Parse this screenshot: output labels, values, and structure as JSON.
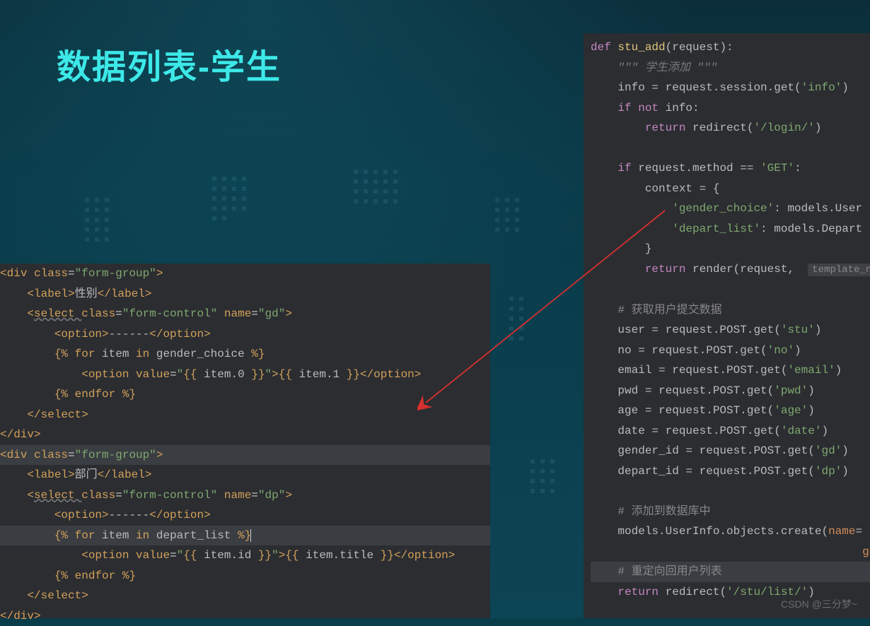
{
  "title": "数据列表-学生",
  "watermark": "CSDN @三分梦~",
  "left_code": {
    "lines": [
      {
        "indent": 0,
        "tokens": [
          {
            "t": "<",
            "c": "tag"
          },
          {
            "t": "div ",
            "c": "tag"
          },
          {
            "t": "class",
            "c": "attr"
          },
          {
            "t": "=",
            "c": "op"
          },
          {
            "t": "\"form-group\"",
            "c": "str"
          },
          {
            "t": ">",
            "c": "tag"
          }
        ]
      },
      {
        "indent": 1,
        "tokens": [
          {
            "t": "<",
            "c": "tag"
          },
          {
            "t": "label",
            "c": "tag"
          },
          {
            "t": ">",
            "c": "tag"
          },
          {
            "t": "性别",
            "c": "txt"
          },
          {
            "t": "</",
            "c": "tag"
          },
          {
            "t": "label",
            "c": "tag"
          },
          {
            "t": ">",
            "c": "tag"
          }
        ]
      },
      {
        "indent": 1,
        "tokens": [
          {
            "t": "<",
            "c": "tag"
          },
          {
            "t": "select ",
            "c": "tag underline"
          },
          {
            "t": "class",
            "c": "attr"
          },
          {
            "t": "=",
            "c": "op"
          },
          {
            "t": "\"form-control\"",
            "c": "str"
          },
          {
            "t": " name",
            "c": "attr"
          },
          {
            "t": "=",
            "c": "op"
          },
          {
            "t": "\"gd\"",
            "c": "str"
          },
          {
            "t": ">",
            "c": "tag"
          }
        ]
      },
      {
        "indent": 2,
        "tokens": [
          {
            "t": "<",
            "c": "tag"
          },
          {
            "t": "option",
            "c": "tag"
          },
          {
            "t": ">",
            "c": "tag"
          },
          {
            "t": "------",
            "c": "txt"
          },
          {
            "t": "</",
            "c": "tag"
          },
          {
            "t": "option",
            "c": "tag"
          },
          {
            "t": ">",
            "c": "tag"
          }
        ]
      },
      {
        "indent": 2,
        "tokens": [
          {
            "t": "{% ",
            "c": "dj"
          },
          {
            "t": "for ",
            "c": "dj"
          },
          {
            "t": "item ",
            "c": "txt"
          },
          {
            "t": "in ",
            "c": "dj"
          },
          {
            "t": "gender_choice ",
            "c": "txt"
          },
          {
            "t": "%}",
            "c": "dj"
          }
        ]
      },
      {
        "indent": 3,
        "tokens": [
          {
            "t": "<",
            "c": "tag"
          },
          {
            "t": "option ",
            "c": "tag"
          },
          {
            "t": "value",
            "c": "attr"
          },
          {
            "t": "=",
            "c": "op"
          },
          {
            "t": "\"",
            "c": "str"
          },
          {
            "t": "{{ ",
            "c": "dj"
          },
          {
            "t": "item.0 ",
            "c": "txt"
          },
          {
            "t": "}}",
            "c": "dj"
          },
          {
            "t": "\"",
            "c": "str"
          },
          {
            "t": ">",
            "c": "tag"
          },
          {
            "t": "{{ ",
            "c": "dj"
          },
          {
            "t": "item.1 ",
            "c": "txt"
          },
          {
            "t": "}}",
            "c": "dj"
          },
          {
            "t": "</",
            "c": "tag"
          },
          {
            "t": "option",
            "c": "tag"
          },
          {
            "t": ">",
            "c": "tag"
          }
        ]
      },
      {
        "indent": 2,
        "tokens": [
          {
            "t": "{% ",
            "c": "dj"
          },
          {
            "t": "endfor ",
            "c": "dj"
          },
          {
            "t": "%}",
            "c": "dj"
          }
        ]
      },
      {
        "indent": 1,
        "tokens": [
          {
            "t": "</",
            "c": "tag"
          },
          {
            "t": "select",
            "c": "tag"
          },
          {
            "t": ">",
            "c": "tag"
          }
        ]
      },
      {
        "indent": 0,
        "tokens": [
          {
            "t": "</",
            "c": "tag"
          },
          {
            "t": "div",
            "c": "tag"
          },
          {
            "t": ">",
            "c": "tag"
          }
        ]
      },
      {
        "indent": 0,
        "hl": true,
        "tokens": [
          {
            "t": "<",
            "c": "tag"
          },
          {
            "t": "div ",
            "c": "tag"
          },
          {
            "t": "class",
            "c": "attr"
          },
          {
            "t": "=",
            "c": "op"
          },
          {
            "t": "\"form-group\"",
            "c": "str"
          },
          {
            "t": ">",
            "c": "tag"
          }
        ]
      },
      {
        "indent": 1,
        "tokens": [
          {
            "t": "<",
            "c": "tag"
          },
          {
            "t": "label",
            "c": "tag"
          },
          {
            "t": ">",
            "c": "tag"
          },
          {
            "t": "部门",
            "c": "txt"
          },
          {
            "t": "</",
            "c": "tag"
          },
          {
            "t": "label",
            "c": "tag"
          },
          {
            "t": ">",
            "c": "tag"
          }
        ]
      },
      {
        "indent": 1,
        "tokens": [
          {
            "t": "<",
            "c": "tag"
          },
          {
            "t": "select ",
            "c": "tag underline"
          },
          {
            "t": "class",
            "c": "attr"
          },
          {
            "t": "=",
            "c": "op"
          },
          {
            "t": "\"form-control\"",
            "c": "str"
          },
          {
            "t": " name",
            "c": "attr"
          },
          {
            "t": "=",
            "c": "op"
          },
          {
            "t": "\"dp\"",
            "c": "str"
          },
          {
            "t": ">",
            "c": "tag"
          }
        ]
      },
      {
        "indent": 2,
        "tokens": [
          {
            "t": "<",
            "c": "tag"
          },
          {
            "t": "option",
            "c": "tag"
          },
          {
            "t": ">",
            "c": "tag"
          },
          {
            "t": "------",
            "c": "txt"
          },
          {
            "t": "</",
            "c": "tag"
          },
          {
            "t": "option",
            "c": "tag"
          },
          {
            "t": ">",
            "c": "tag"
          }
        ]
      },
      {
        "indent": 2,
        "hl": true,
        "tokens": [
          {
            "t": "{% ",
            "c": "dj"
          },
          {
            "t": "for ",
            "c": "dj"
          },
          {
            "t": "item ",
            "c": "txt"
          },
          {
            "t": "in ",
            "c": "dj"
          },
          {
            "t": "depart_list ",
            "c": "txt"
          },
          {
            "t": "%}",
            "c": "dj"
          },
          {
            "t": "",
            "c": "cursor"
          }
        ]
      },
      {
        "indent": 3,
        "tokens": [
          {
            "t": "<",
            "c": "tag"
          },
          {
            "t": "option ",
            "c": "tag"
          },
          {
            "t": "value",
            "c": "attr"
          },
          {
            "t": "=",
            "c": "op"
          },
          {
            "t": "\"",
            "c": "str"
          },
          {
            "t": "{{ ",
            "c": "dj"
          },
          {
            "t": "item.id ",
            "c": "txt"
          },
          {
            "t": "}}",
            "c": "dj"
          },
          {
            "t": "\"",
            "c": "str"
          },
          {
            "t": ">",
            "c": "tag"
          },
          {
            "t": "{{ ",
            "c": "dj"
          },
          {
            "t": "item.title ",
            "c": "txt"
          },
          {
            "t": "}}",
            "c": "dj"
          },
          {
            "t": "</",
            "c": "tag"
          },
          {
            "t": "option",
            "c": "tag"
          },
          {
            "t": ">",
            "c": "tag"
          }
        ]
      },
      {
        "indent": 2,
        "tokens": [
          {
            "t": "{% ",
            "c": "dj"
          },
          {
            "t": "endfor ",
            "c": "dj"
          },
          {
            "t": "%}",
            "c": "dj"
          }
        ]
      },
      {
        "indent": 1,
        "tokens": [
          {
            "t": "</",
            "c": "tag"
          },
          {
            "t": "select",
            "c": "tag"
          },
          {
            "t": ">",
            "c": "tag"
          }
        ]
      },
      {
        "indent": 0,
        "tokens": [
          {
            "t": "</",
            "c": "tag"
          },
          {
            "t": "div",
            "c": "tag"
          },
          {
            "t": ">",
            "c": "tag"
          }
        ]
      }
    ]
  },
  "right_code": {
    "lines": [
      {
        "indent": 0,
        "tokens": [
          {
            "t": "def ",
            "c": "kw2"
          },
          {
            "t": "stu_add",
            "c": "fn"
          },
          {
            "t": "(request):",
            "c": "txt"
          }
        ]
      },
      {
        "indent": 1,
        "tokens": [
          {
            "t": "\"\"\" ",
            "c": "docstr"
          },
          {
            "t": "学生添加",
            "c": "docstr"
          },
          {
            "t": " \"\"\"",
            "c": "docstr"
          }
        ]
      },
      {
        "indent": 1,
        "tokens": [
          {
            "t": "info = request.session.get(",
            "c": "txt"
          },
          {
            "t": "'info'",
            "c": "str2"
          },
          {
            "t": ")",
            "c": "txt"
          }
        ]
      },
      {
        "indent": 1,
        "tokens": [
          {
            "t": "if ",
            "c": "kw2"
          },
          {
            "t": "not ",
            "c": "kw2"
          },
          {
            "t": "info:",
            "c": "txt"
          }
        ]
      },
      {
        "indent": 2,
        "tokens": [
          {
            "t": "return ",
            "c": "kw2"
          },
          {
            "t": "redirect(",
            "c": "txt"
          },
          {
            "t": "'/login/'",
            "c": "str2"
          },
          {
            "t": ")",
            "c": "txt"
          }
        ]
      },
      {
        "indent": 0,
        "tokens": [
          {
            "t": " ",
            "c": "txt"
          }
        ]
      },
      {
        "indent": 1,
        "tokens": [
          {
            "t": "if ",
            "c": "kw2"
          },
          {
            "t": "request.method == ",
            "c": "txt"
          },
          {
            "t": "'GET'",
            "c": "str2"
          },
          {
            "t": ":",
            "c": "txt"
          }
        ]
      },
      {
        "indent": 2,
        "tokens": [
          {
            "t": "context = {",
            "c": "txt"
          }
        ]
      },
      {
        "indent": 3,
        "tokens": [
          {
            "t": "'gender_choice'",
            "c": "str2"
          },
          {
            "t": ": models.User",
            "c": "txt"
          }
        ]
      },
      {
        "indent": 3,
        "tokens": [
          {
            "t": "'depart_list'",
            "c": "str2"
          },
          {
            "t": ": models.Depart",
            "c": "txt"
          }
        ]
      },
      {
        "indent": 2,
        "tokens": [
          {
            "t": "}",
            "c": "txt"
          }
        ]
      },
      {
        "indent": 2,
        "tokens": [
          {
            "t": "return ",
            "c": "kw2"
          },
          {
            "t": "render(request,  ",
            "c": "txt"
          },
          {
            "t": "template_n",
            "c": "hint"
          }
        ]
      },
      {
        "indent": 0,
        "tokens": [
          {
            "t": " ",
            "c": "txt"
          }
        ]
      },
      {
        "indent": 1,
        "tokens": [
          {
            "t": "# 获取用户提交数据",
            "c": "cmt"
          }
        ]
      },
      {
        "indent": 1,
        "tokens": [
          {
            "t": "user = request.POST.get(",
            "c": "txt"
          },
          {
            "t": "'stu'",
            "c": "str2"
          },
          {
            "t": ")",
            "c": "txt"
          }
        ]
      },
      {
        "indent": 1,
        "tokens": [
          {
            "t": "no = request.POST.get(",
            "c": "txt"
          },
          {
            "t": "'no'",
            "c": "str2"
          },
          {
            "t": ")",
            "c": "txt"
          }
        ]
      },
      {
        "indent": 1,
        "tokens": [
          {
            "t": "email = request.POST.get(",
            "c": "txt"
          },
          {
            "t": "'email'",
            "c": "str2"
          },
          {
            "t": ")",
            "c": "txt"
          }
        ]
      },
      {
        "indent": 1,
        "tokens": [
          {
            "t": "pwd = request.POST.get(",
            "c": "txt"
          },
          {
            "t": "'pwd'",
            "c": "str2"
          },
          {
            "t": ")",
            "c": "txt"
          }
        ]
      },
      {
        "indent": 1,
        "tokens": [
          {
            "t": "age = request.POST.get(",
            "c": "txt"
          },
          {
            "t": "'age'",
            "c": "str2"
          },
          {
            "t": ")",
            "c": "txt"
          }
        ]
      },
      {
        "indent": 1,
        "tokens": [
          {
            "t": "date = request.POST.get(",
            "c": "txt"
          },
          {
            "t": "'date'",
            "c": "str2"
          },
          {
            "t": ")",
            "c": "txt"
          }
        ]
      },
      {
        "indent": 1,
        "tokens": [
          {
            "t": "gender_id = request.POST.get(",
            "c": "txt"
          },
          {
            "t": "'gd'",
            "c": "str2"
          },
          {
            "t": ")",
            "c": "txt"
          }
        ]
      },
      {
        "indent": 1,
        "tokens": [
          {
            "t": "depart_id = request.POST.get(",
            "c": "txt"
          },
          {
            "t": "'dp'",
            "c": "str2"
          },
          {
            "t": ")",
            "c": "txt"
          }
        ]
      },
      {
        "indent": 0,
        "tokens": [
          {
            "t": " ",
            "c": "txt"
          }
        ]
      },
      {
        "indent": 1,
        "tokens": [
          {
            "t": "# 添加到数据库中",
            "c": "cmt"
          }
        ]
      },
      {
        "indent": 1,
        "tokens": [
          {
            "t": "models.UserInfo.objects.create(",
            "c": "txt"
          },
          {
            "t": "name",
            "c": "orange-attr"
          },
          {
            "t": "=",
            "c": "txt"
          }
        ]
      },
      {
        "indent": 10,
        "tokens": [
          {
            "t": "gende",
            "c": "orange-attr"
          }
        ]
      },
      {
        "indent": 1,
        "hl": true,
        "tokens": [
          {
            "t": "# 重定向回用户列表",
            "c": "cmt"
          }
        ]
      },
      {
        "indent": 1,
        "tokens": [
          {
            "t": "return ",
            "c": "kw2"
          },
          {
            "t": "redirect(",
            "c": "txt"
          },
          {
            "t": "'/stu/list/'",
            "c": "str2"
          },
          {
            "t": ")",
            "c": "txt"
          }
        ]
      }
    ]
  }
}
